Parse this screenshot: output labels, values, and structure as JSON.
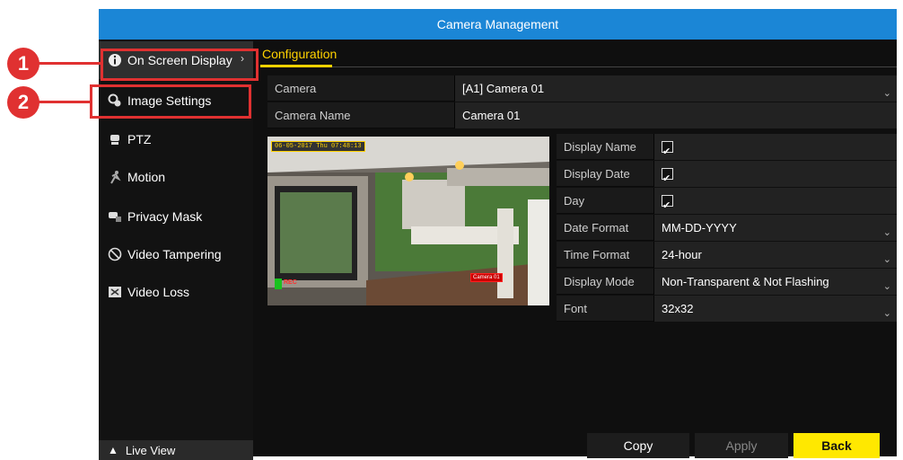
{
  "window": {
    "title": "Camera Management"
  },
  "sidebar": {
    "items": [
      {
        "label": "On Screen Display",
        "icon": "info-icon"
      },
      {
        "label": "Image Settings",
        "icon": "image-settings-icon"
      },
      {
        "label": "PTZ",
        "icon": "ptz-icon"
      },
      {
        "label": "Motion",
        "icon": "motion-icon"
      },
      {
        "label": "Privacy Mask",
        "icon": "privacy-mask-icon"
      },
      {
        "label": "Video Tampering",
        "icon": "video-tampering-icon"
      },
      {
        "label": "Video Loss",
        "icon": "video-loss-icon"
      }
    ],
    "live_view": "Live View"
  },
  "tabs": {
    "configuration": "Configuration"
  },
  "form": {
    "camera": {
      "label": "Camera",
      "value": "[A1] Camera 01"
    },
    "camera_name": {
      "label": "Camera Name",
      "value": "Camera 01"
    },
    "display_name": {
      "label": "Display Name",
      "checked": true
    },
    "display_date": {
      "label": "Display Date",
      "checked": true
    },
    "day": {
      "label": "Day",
      "checked": true
    },
    "date_format": {
      "label": "Date Format",
      "value": "MM-DD-YYYY"
    },
    "time_format": {
      "label": "Time Format",
      "value": "24-hour"
    },
    "display_mode": {
      "label": "Display Mode",
      "value": "Non-Transparent & Not Flashing"
    },
    "font": {
      "label": "Font",
      "value": "32x32"
    }
  },
  "preview": {
    "osd_datetime": "06-05-2017 Thu 07:48:13",
    "rec_label": "REC",
    "camera_label": "Camera 01"
  },
  "buttons": {
    "copy": "Copy",
    "apply": "Apply",
    "back": "Back"
  },
  "callouts": [
    "1",
    "2"
  ],
  "colors": {
    "title_bar": "#1b86d6",
    "accent_yellow": "#ffe800",
    "callout_red": "#e03131"
  }
}
